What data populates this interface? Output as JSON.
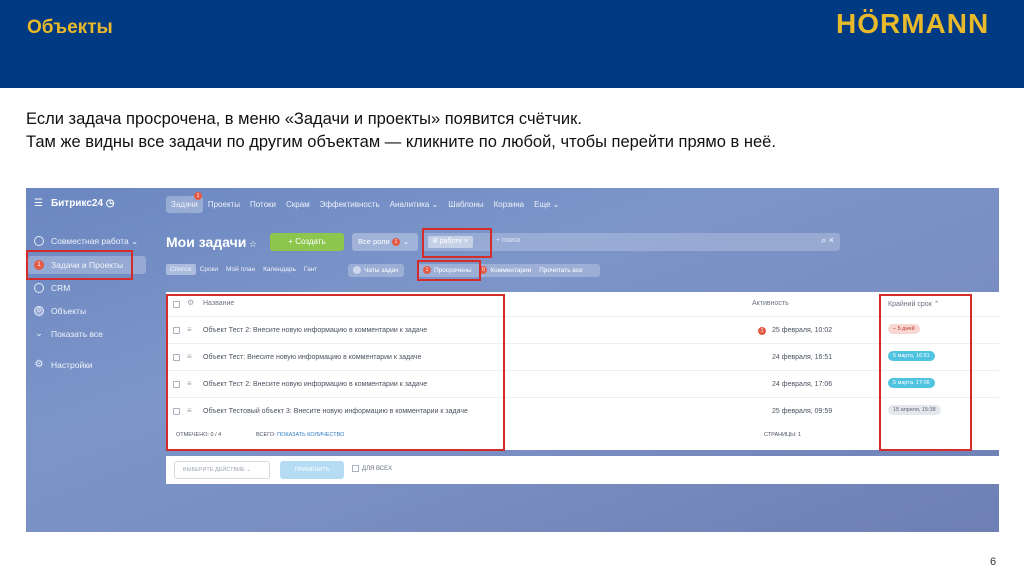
{
  "header": {
    "title": "Объекты",
    "logo_text": "HÖRMANN",
    "colors": {
      "banner": "#003a82",
      "accent": "#e8b92a"
    }
  },
  "caption": {
    "line1": "Если задача просрочена, в меню «Задачи и проекты» появится счётчик.",
    "line2": "Там же видны все задачи по другим объектам — кликните по любой, чтобы перейти прямо в неё."
  },
  "page_number": "6",
  "app": {
    "brand": "Битрикс24",
    "sidebar": [
      {
        "label": "Совместная работа",
        "icon": "chat-icon"
      },
      {
        "label": "Задачи и Проекты",
        "icon": "tasks-icon",
        "badge": "1"
      },
      {
        "label": "CRM",
        "icon": "crm-icon"
      },
      {
        "label": "Объекты",
        "icon": "objects-icon",
        "badge": "0"
      },
      {
        "label": "Показать все",
        "icon": "chevron-down-icon"
      },
      {
        "label": "Настройки",
        "icon": "gear-icon"
      }
    ],
    "topnav": [
      "Задачи",
      "Проекты",
      "Потоки",
      "Скрам",
      "Эффективность",
      "Аналитика ⌄",
      "Шаблоны",
      "Корзина",
      "Еще ⌄"
    ],
    "topnav_badge": "1",
    "page_title": "Мои задачи",
    "create_label": "+ Создать",
    "roles_label": "Все роли",
    "roles_badge": "1",
    "filter_chip": "В работе",
    "search_placeholder": "+ поиск",
    "subtabs": [
      "Список",
      "Сроки",
      "Мой план",
      "Календарь",
      "Гант"
    ],
    "chats_label": "Чаты задач",
    "overdue_label": "Просрочены",
    "overdue_badge": "1",
    "comments_label": "Комментарии",
    "read_all_label": "Прочитать все",
    "table": {
      "col_name": "Название",
      "col_activity": "Активность",
      "col_deadline": "Крайний срок ⌃",
      "rows": [
        {
          "name": "Объект Тест 2: Внесите новую информацию в комментарии к задаче",
          "activity": "25 февраля, 10:02",
          "overdue_badge": "1",
          "deadline": "– 5 дней",
          "deadline_style": "red"
        },
        {
          "name": "Объект Тест: Внесите новую информацию в комментарии к задаче",
          "activity": "24 февраля, 16:51",
          "deadline": "5 марта, 16:51",
          "deadline_style": "blue"
        },
        {
          "name": "Объект Тест 2: Внесите новую информацию в комментарии к задаче",
          "activity": "24 февраля, 17:06",
          "deadline": "5 марта, 17:06",
          "deadline_style": "blue"
        },
        {
          "name": "Объект Тестовый объект 3: Внесите новую информацию в комментарии к задаче",
          "activity": "25 февраля, 09:59",
          "deadline": "15 апреля, 15:38",
          "deadline_style": "gray"
        }
      ],
      "selected": "ОТМЕЧЕНО: 0 / 4",
      "total_prefix": "ВСЕГО:",
      "total_link": "ПОКАЗАТЬ КОЛИЧЕСТВО",
      "pages": "СТРАНИЦЫ: 1"
    },
    "select_action": "ВЫБЕРИТЕ ДЕЙСТВИЕ",
    "apply_label": "ПРИМЕНИТЬ",
    "for_all_label": "ДЛЯ ВСЕХ"
  }
}
